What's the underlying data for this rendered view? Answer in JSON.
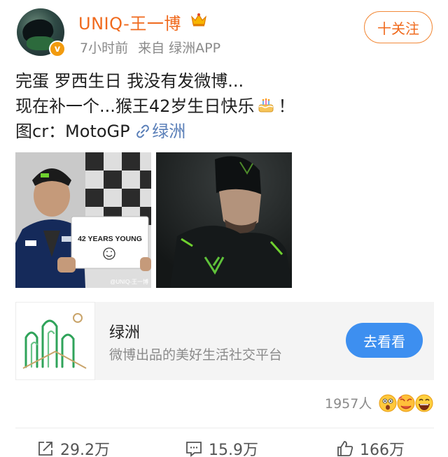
{
  "post": {
    "author": "UNIQ-王一博",
    "time": "7小时前",
    "source": "来自 绿洲APP",
    "follow_label": "十关注",
    "text_line1": "完蛋 罗西生日 我没有发微博...",
    "text_line2_a": "现在补一个...猴王42岁生日快乐",
    "text_line2_b": "！",
    "text_line3_prefix": "图cr：MotoGP",
    "text_line3_link": "绿洲"
  },
  "images": [
    {
      "sign_text": "42 YEARS YOUNG",
      "watermark": "@UNIQ-王一博"
    },
    {
      "sign_text": ""
    }
  ],
  "card": {
    "title": "绿洲",
    "subtitle": "微博出品的美好生活社交平台",
    "button": "去看看"
  },
  "reactions": {
    "count": "1957人"
  },
  "actions": {
    "repost": "29.2万",
    "comment": "15.9万",
    "like": "166万"
  },
  "colors": {
    "accent_orange": "#f06a1d",
    "link_blue": "#5a7fb8",
    "button_blue": "#3d8ff0",
    "meta_gray": "#8a8a8a"
  },
  "icons": [
    "crown-icon",
    "verified-badge-icon",
    "cake-icon",
    "link-icon",
    "oasis-logo-icon",
    "repost-icon",
    "comment-icon",
    "like-icon"
  ]
}
